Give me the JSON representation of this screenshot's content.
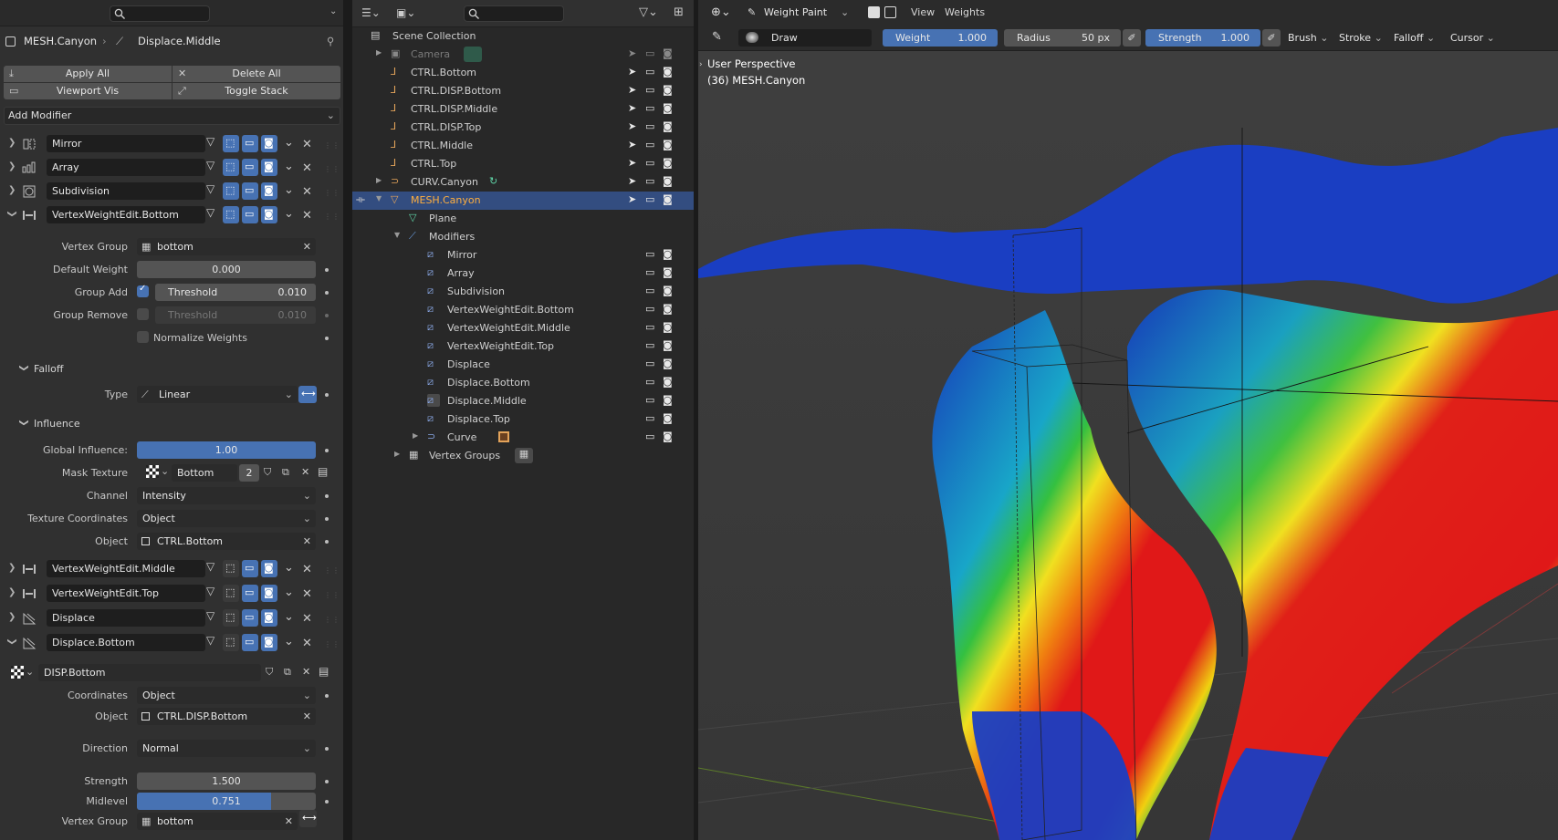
{
  "properties": {
    "object_name": "MESH.Canyon",
    "active_modifier": "Displace.Middle",
    "buttons": {
      "apply_all": "Apply All",
      "delete_all": "Delete All",
      "viewport_vis": "Viewport Vis",
      "toggle_stack": "Toggle Stack"
    },
    "add_modifier": "Add Modifier",
    "modifiers": [
      {
        "name": "Mirror",
        "expanded": false
      },
      {
        "name": "Array",
        "expanded": false
      },
      {
        "name": "Subdivision",
        "expanded": false
      },
      {
        "name": "VertexWeightEdit.Bottom",
        "expanded": true
      },
      {
        "name": "VertexWeightEdit.Middle",
        "expanded": false
      },
      {
        "name": "VertexWeightEdit.Top",
        "expanded": false
      },
      {
        "name": "Displace",
        "expanded": false
      },
      {
        "name": "Displace.Bottom",
        "expanded": true
      }
    ],
    "vwe": {
      "vertex_group_label": "Vertex Group",
      "vertex_group": "bottom",
      "default_weight_label": "Default Weight",
      "default_weight": "0.000",
      "group_add_label": "Group Add",
      "threshold_label": "Threshold",
      "group_add_threshold": "0.010",
      "group_remove_label": "Group Remove",
      "group_remove_threshold": "0.010",
      "normalize_label": "Normalize Weights",
      "falloff_section": "Falloff",
      "type_label": "Type",
      "type_value": "Linear",
      "influence_section": "Influence",
      "global_influence_label": "Global Influence:",
      "global_influence": "1.00",
      "mask_texture_label": "Mask Texture",
      "mask_texture": "Bottom",
      "mask_users": "2",
      "channel_label": "Channel",
      "channel": "Intensity",
      "texcoords_label": "Texture Coordinates",
      "texcoords": "Object",
      "object_label": "Object",
      "object": "CTRL.Bottom"
    },
    "displace": {
      "texture": "DISP.Bottom",
      "coordinates_label": "Coordinates",
      "coordinates": "Object",
      "object_label": "Object",
      "object": "CTRL.DISP.Bottom",
      "direction_label": "Direction",
      "direction": "Normal",
      "strength_label": "Strength",
      "strength": "1.500",
      "midlevel_label": "Midlevel",
      "midlevel": "0.751",
      "midlevel_fraction": 0.751,
      "vertex_group_label": "Vertex Group",
      "vertex_group": "bottom"
    }
  },
  "outliner": {
    "scene_collection": "Scene Collection",
    "objects": [
      {
        "name": "Camera",
        "dim": true
      },
      {
        "name": "CTRL.Bottom"
      },
      {
        "name": "CTRL.DISP.Bottom"
      },
      {
        "name": "CTRL.DISP.Middle"
      },
      {
        "name": "CTRL.DISP.Top"
      },
      {
        "name": "CTRL.Middle"
      },
      {
        "name": "CTRL.Top"
      },
      {
        "name": "CURV.Canyon"
      },
      {
        "name": "MESH.Canyon",
        "selected": true
      }
    ],
    "plane": "Plane",
    "modifiers_label": "Modifiers",
    "modifier_items": [
      "Mirror",
      "Array",
      "Subdivision",
      "VertexWeightEdit.Bottom",
      "VertexWeightEdit.Middle",
      "VertexWeightEdit.Top",
      "Displace",
      "Displace.Bottom",
      "Displace.Middle",
      "Displace.Top",
      "Curve"
    ],
    "vertex_groups": "Vertex Groups"
  },
  "viewport": {
    "mode": "Weight Paint",
    "menus": [
      "View",
      "Weights"
    ],
    "brush_name": "Draw",
    "weight_label": "Weight",
    "weight": "1.000",
    "radius_label": "Radius",
    "radius": "50 px",
    "strength_label": "Strength",
    "strength": "1.000",
    "dropdowns": [
      "Brush",
      "Stroke",
      "Falloff",
      "Cursor"
    ],
    "overlay_line1": "User Perspective",
    "overlay_line2": "(36) MESH.Canyon",
    "colors": {
      "accent": "#4772b3",
      "selected_row": "#334d80"
    }
  }
}
